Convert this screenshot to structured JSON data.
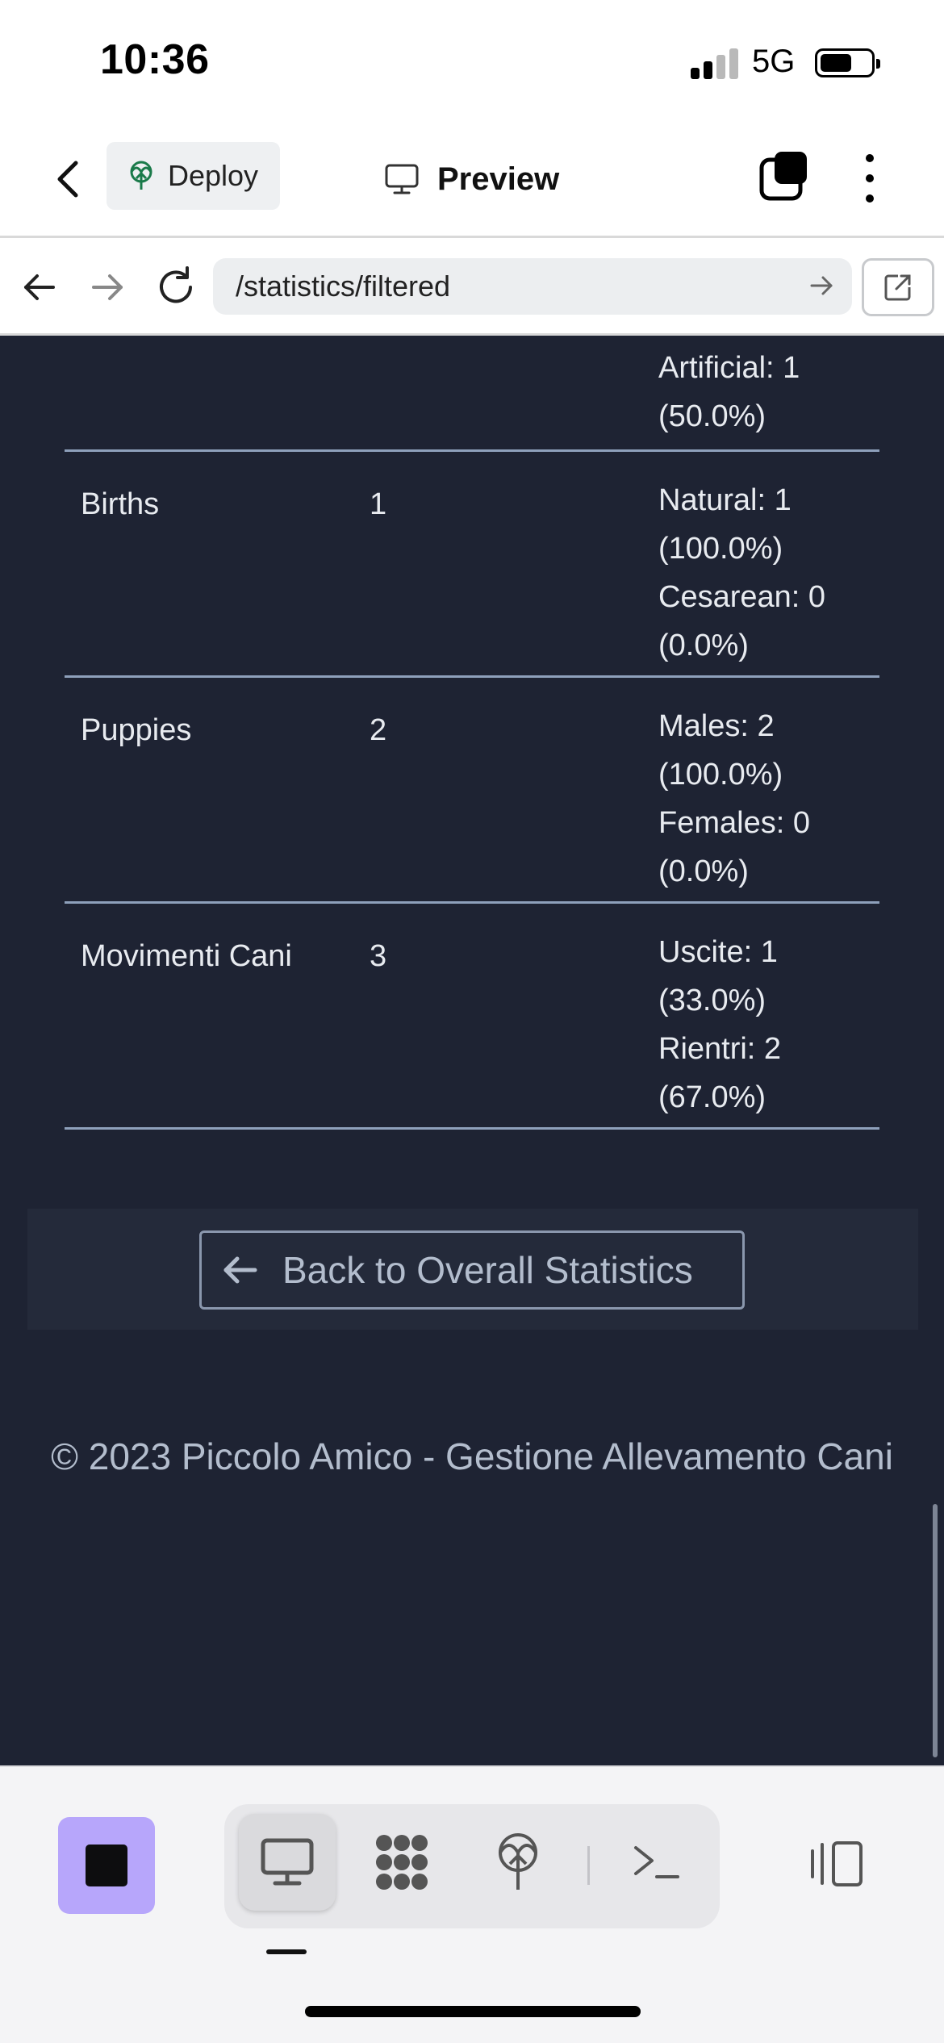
{
  "status_bar": {
    "time": "10:36",
    "network": "5G"
  },
  "header": {
    "deploy_label": "Deploy",
    "preview_label": "Preview"
  },
  "url_bar": {
    "url": "/statistics/filtered"
  },
  "stats_table": {
    "rows": [
      {
        "name": "",
        "count": "",
        "details": [
          "Artificial: 1",
          "(50.0%)"
        ]
      },
      {
        "name": "Births",
        "count": "1",
        "details": [
          "Natural: 1",
          "(100.0%)",
          "Cesarean: 0",
          "(0.0%)"
        ]
      },
      {
        "name": "Puppies",
        "count": "2",
        "details": [
          "Males: 2",
          "(100.0%)",
          "Females: 0",
          "(0.0%)"
        ]
      },
      {
        "name": "Movimenti Cani",
        "count": "3",
        "details": [
          "Uscite: 1",
          "(33.0%)",
          "Rientri: 2",
          "(67.0%)"
        ]
      }
    ]
  },
  "back_link": {
    "label": "Back to Overall Statistics"
  },
  "footer": {
    "text": "© 2023 Piccolo Amico - Gestione Allevamento Cani"
  },
  "colors": {
    "content_bg": "#1e2333",
    "stop_button": "#b7a6fb",
    "deploy_icon": "#1a7a4a"
  }
}
